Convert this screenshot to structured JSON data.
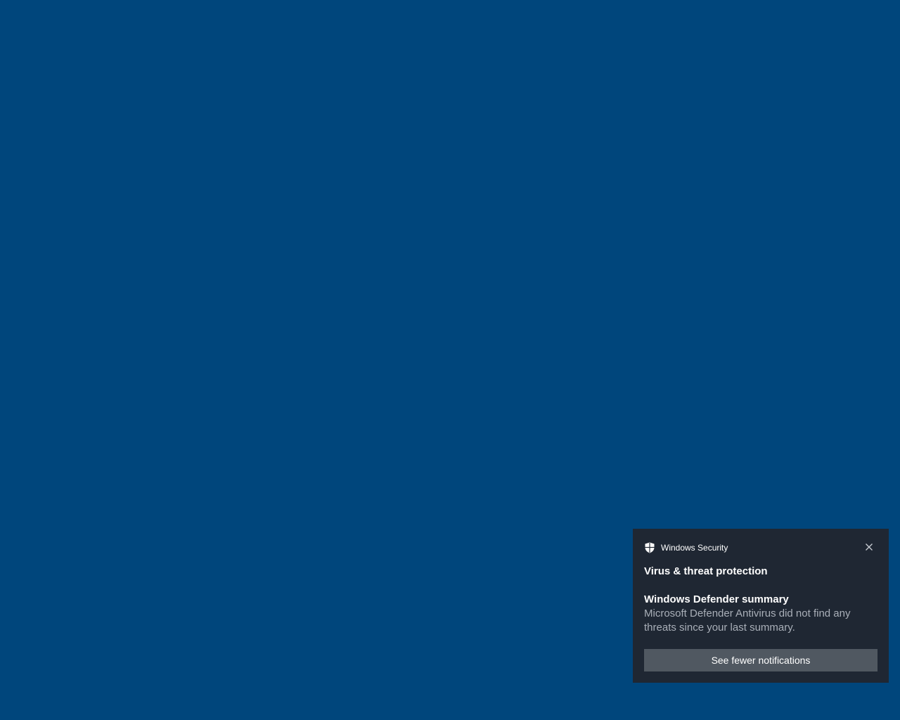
{
  "desktop": {
    "background_color": "#00467c"
  },
  "toast": {
    "background_color": "#1f2733",
    "app_name": "Windows Security",
    "app_icon": "shield-icon",
    "close_icon": "close-icon",
    "title": "Virus & threat protection",
    "heading": "Windows Defender summary",
    "body": "Microsoft Defender Antivirus did not find any threats since your last summary.",
    "action_label": "See fewer notifications",
    "action_color": "#505861"
  }
}
